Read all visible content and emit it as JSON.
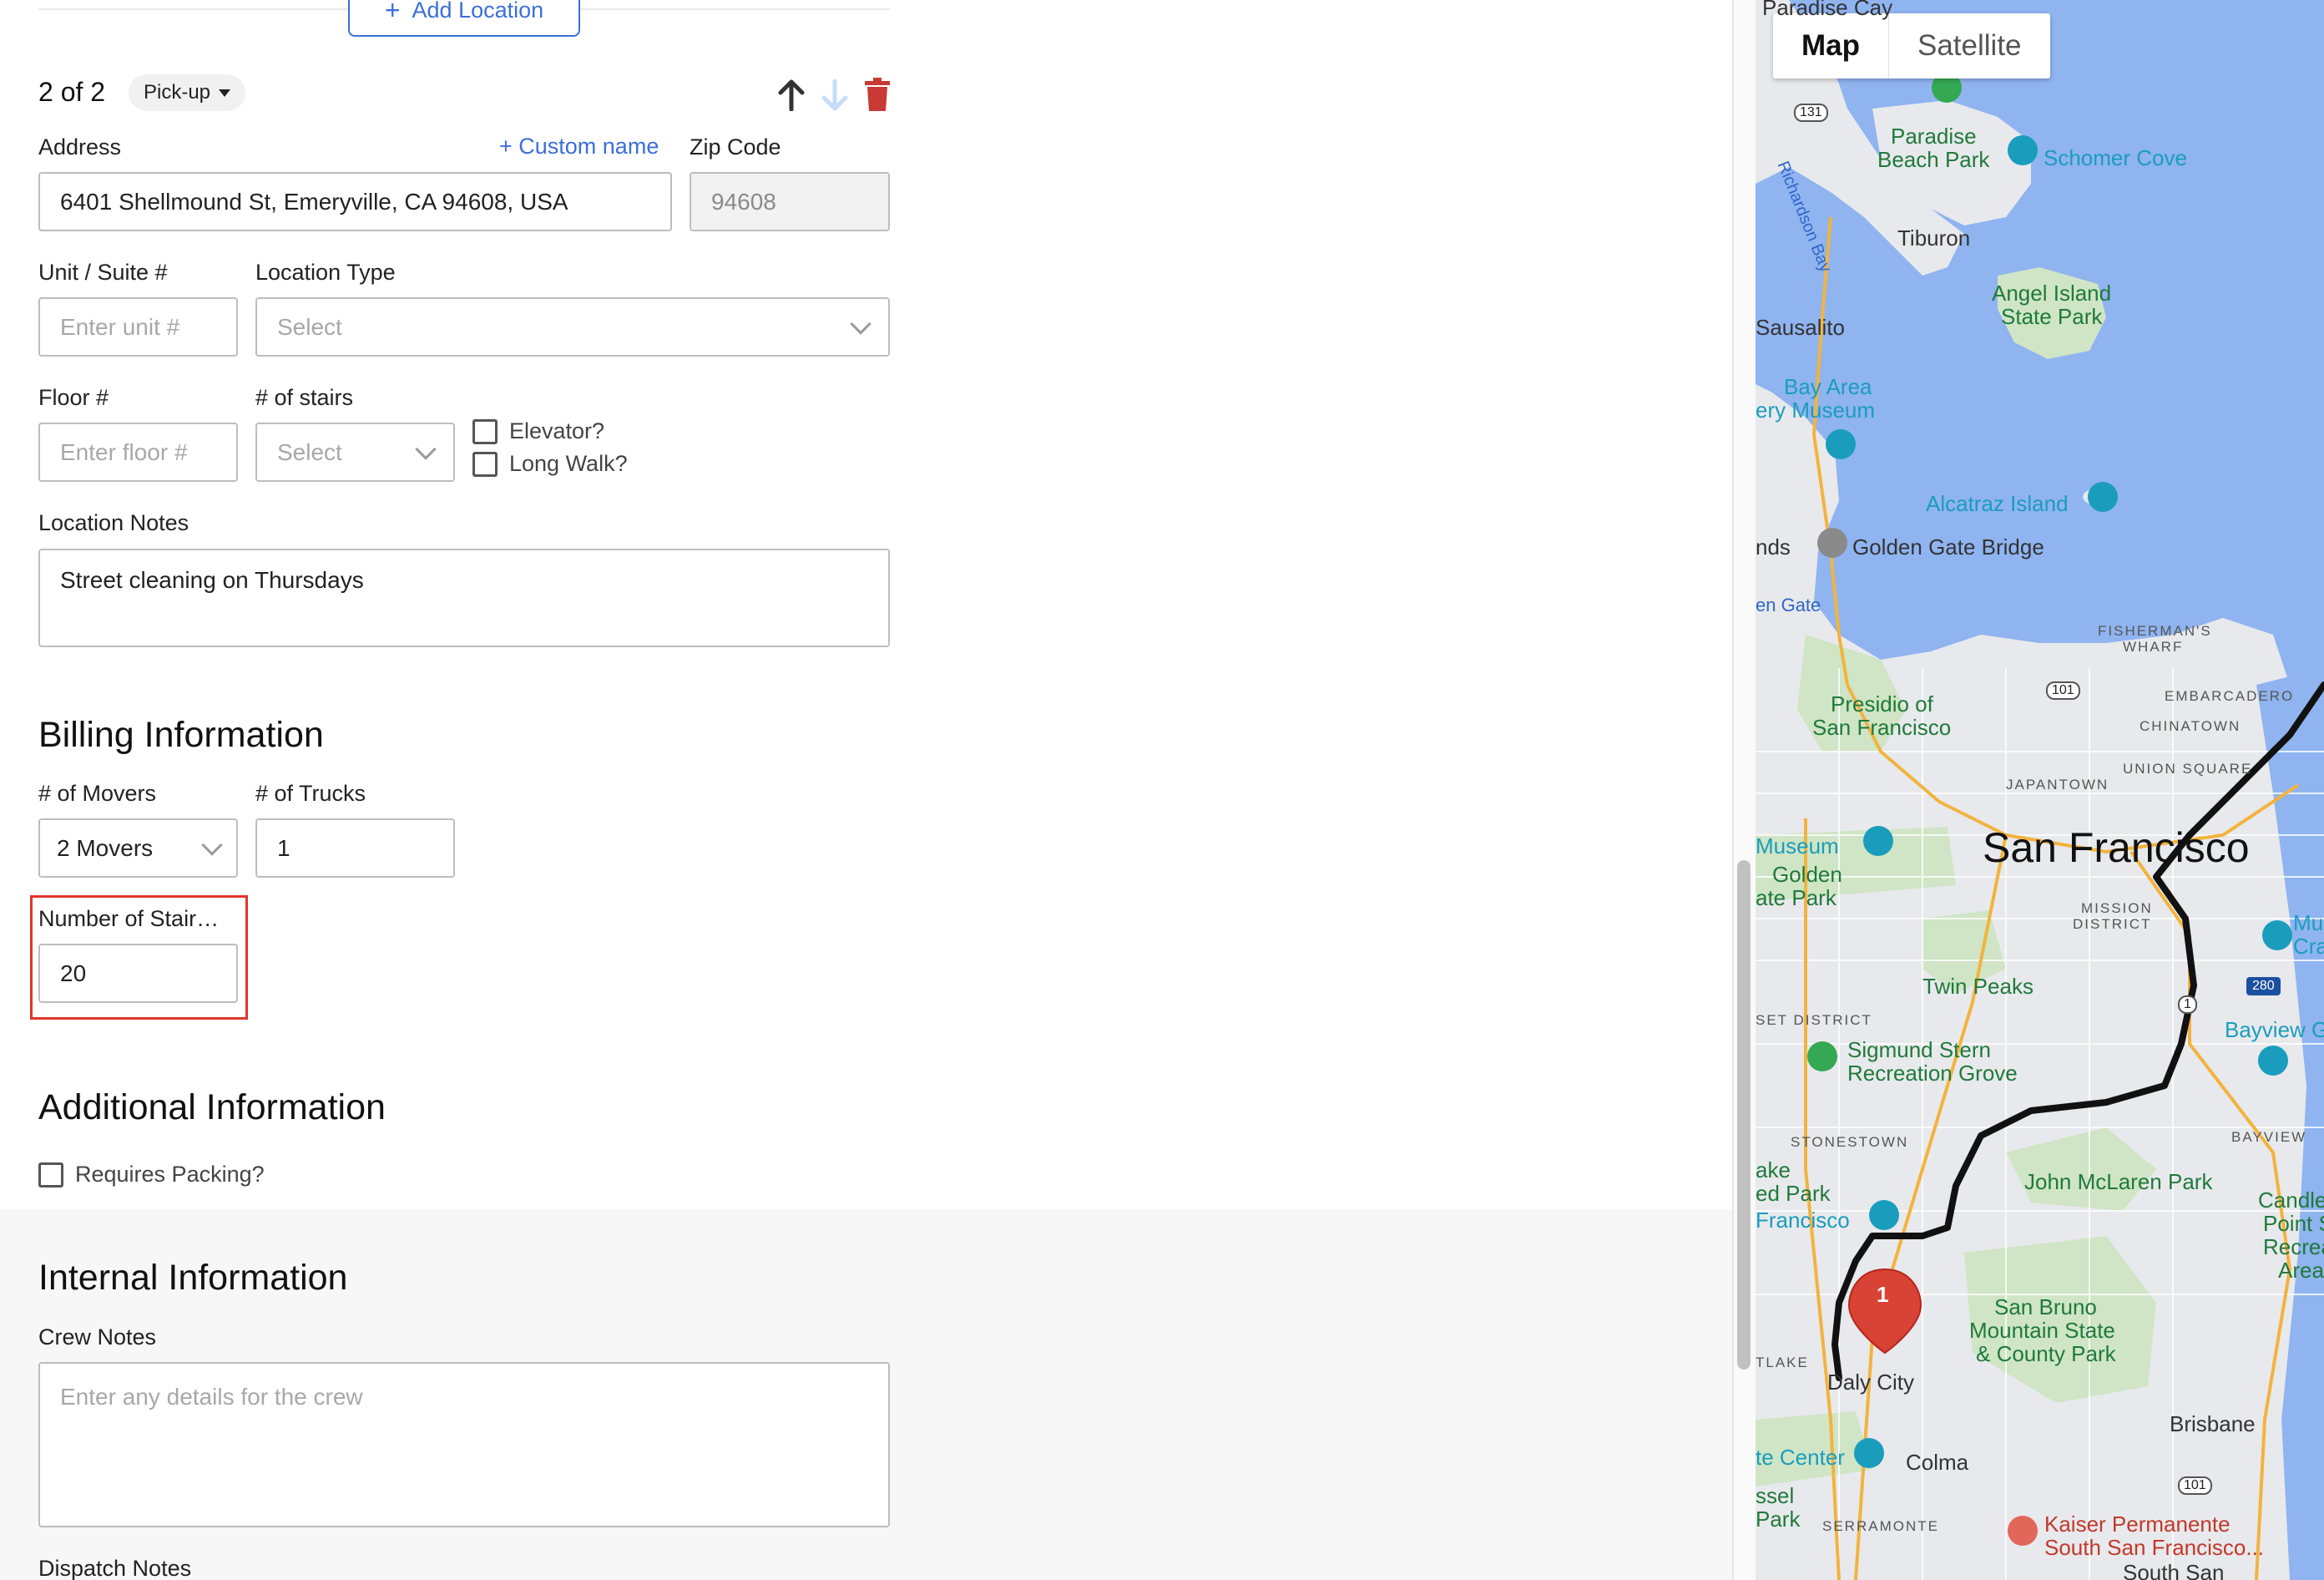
{
  "location_card": {
    "add_location_label": "Add Location",
    "stop_count": "2 of 2",
    "stop_type": "Pick-up",
    "address_label": "Address",
    "custom_name_label": "+ Custom name",
    "zip_label": "Zip Code",
    "address_value": "6401 Shellmound St, Emeryville, CA 94608, USA",
    "zip_value": "94608",
    "unit_label": "Unit / Suite #",
    "unit_placeholder": "Enter unit #",
    "location_type_label": "Location Type",
    "location_type_placeholder": "Select",
    "floor_label": "Floor #",
    "floor_placeholder": "Enter floor #",
    "stairs_label": "# of stairs",
    "stairs_placeholder": "Select",
    "elevator_label": "Elevator?",
    "long_walk_label": "Long Walk?",
    "location_notes_label": "Location Notes",
    "location_notes_value": "Street cleaning on Thursdays"
  },
  "billing": {
    "title": "Billing Information",
    "movers_label": "# of Movers",
    "movers_value": "2 Movers",
    "trucks_label": "# of Trucks",
    "trucks_value": "1",
    "stairs_count_label": "Number of Stair…",
    "stairs_count_value": "20"
  },
  "additional": {
    "title": "Additional Information",
    "requires_packing_label": "Requires Packing?"
  },
  "internal": {
    "title": "Internal Information",
    "crew_notes_label": "Crew Notes",
    "crew_notes_placeholder": "Enter any details for the crew",
    "dispatch_notes_label": "Dispatch Notes"
  },
  "map": {
    "map_button": "Map",
    "satellite_button": "Satellite",
    "marker_label": "1",
    "labels": {
      "paradise_cay": "Paradise Cay",
      "paradise_beach_park_1": "Paradise",
      "paradise_beach_park_2": "Beach Park",
      "schomer_cove": "Schomer Cove",
      "richardson_bay": "Richardson Bay",
      "tiburon": "Tiburon",
      "sausalito": "Sausalito",
      "angel_island_1": "Angel Island",
      "angel_island_2": "State Park",
      "bay_area_1": "Bay Area",
      "bay_area_2": "ery Museum",
      "alcatraz": "Alcatraz Island",
      "golden_gate_bridge": "Golden Gate Bridge",
      "lands": "nds",
      "golden_gate_partial": "en Gate",
      "fishermans_wharf_1": "FISHERMAN'S",
      "fishermans_wharf_2": "WHARF",
      "embarcadero": "EMBARCADERO",
      "chinatown": "CHINATOWN",
      "presidio_1": "Presidio of",
      "presidio_2": "San Francisco",
      "union_square": "UNION SQUARE",
      "japantown": "JAPANTOWN",
      "museum": "Museum",
      "golden_gp_1": "Golden",
      "golden_gp_2": "ate Park",
      "san_francisco": "San Francisco",
      "mission_1": "MISSION",
      "mission_2": "DISTRICT",
      "mu": "Mu",
      "cra": "Cra",
      "twin_peaks": "Twin Peaks",
      "sunset": "SET DISTRICT",
      "bayview": "Bayview G",
      "stern_1": "Sigmund Stern",
      "stern_2": "Recreation Grove",
      "stonestown": "STONESTOWN",
      "bayview_caps": "BAYVIEW",
      "ake": "ake",
      "ed_park": "ed Park",
      "francisco": "Francisco",
      "mclaren": "John McLaren Park",
      "candles_1": "Candles",
      "candles_2": "Point S",
      "candles_3": "Recreat",
      "candles_4": "Area",
      "san_bruno_1": "San Bruno",
      "san_bruno_2": "Mountain State",
      "san_bruno_3": "& County Park",
      "tlake": "TLAKE",
      "daly_city": "Daly City",
      "brisbane": "Brisbane",
      "te_center": "te Center",
      "colma": "Colma",
      "ssel": "ssel",
      "park_sm": "Park",
      "serramonte": "SERRAMONTE",
      "kaiser_1": "Kaiser Permanente",
      "kaiser_2": "South San Francisco...",
      "south_san": "South San"
    },
    "route_shields": [
      "131",
      "101",
      "1",
      "280",
      "101"
    ]
  }
}
